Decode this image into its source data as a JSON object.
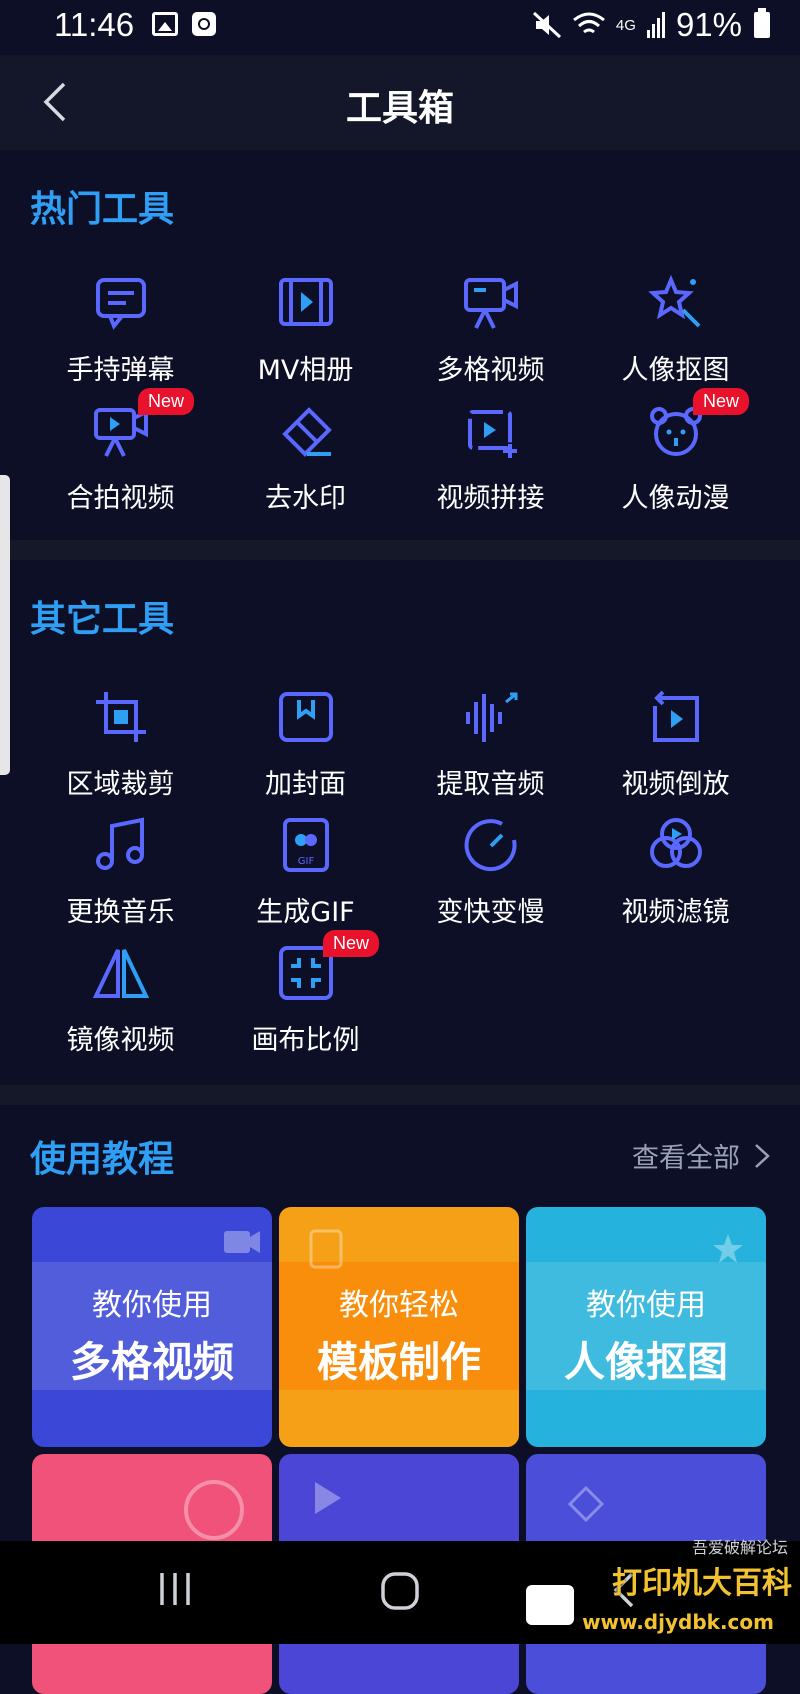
{
  "status_bar": {
    "time": "11:46",
    "battery": "91%",
    "network": "4G"
  },
  "header": {
    "title": "工具箱",
    "back_icon": "chevron-left-icon"
  },
  "hot_tools": {
    "title": "热门工具",
    "items": [
      {
        "label": "手持弹幕",
        "icon": "chat-bubble-icon"
      },
      {
        "label": "MV相册",
        "icon": "film-play-icon"
      },
      {
        "label": "多格视频",
        "icon": "camera-tripod-icon"
      },
      {
        "label": "人像抠图",
        "icon": "magic-star-icon"
      },
      {
        "label": "合拍视频",
        "icon": "video-camera-icon",
        "badge": "New"
      },
      {
        "label": "去水印",
        "icon": "eraser-icon"
      },
      {
        "label": "视频拼接",
        "icon": "video-frame-icon"
      },
      {
        "label": "人像动漫",
        "icon": "bear-face-icon",
        "badge": "New"
      }
    ]
  },
  "other_tools": {
    "title": "其它工具",
    "items": [
      {
        "label": "区域裁剪",
        "icon": "crop-icon"
      },
      {
        "label": "加封面",
        "icon": "cover-icon"
      },
      {
        "label": "提取音频",
        "icon": "audio-wave-icon"
      },
      {
        "label": "视频倒放",
        "icon": "rewind-icon"
      },
      {
        "label": "更换音乐",
        "icon": "music-note-icon"
      },
      {
        "label": "生成GIF",
        "icon": "gif-icon"
      },
      {
        "label": "变快变慢",
        "icon": "speed-gauge-icon"
      },
      {
        "label": "视频滤镜",
        "icon": "filter-circles-icon"
      },
      {
        "label": "镜像视频",
        "icon": "mirror-icon"
      },
      {
        "label": "画布比例",
        "icon": "canvas-ratio-icon",
        "badge": "New"
      }
    ]
  },
  "tutorials": {
    "title": "使用教程",
    "view_all": "查看全部",
    "cards": [
      {
        "line1": "教你使用",
        "line2": "多格视频",
        "color": "#3b47d6"
      },
      {
        "line1": "教你轻松",
        "line2": "模板制作",
        "color": "#f5a016"
      },
      {
        "line1": "教你使用",
        "line2": "人像抠图",
        "color": "#25b2dc"
      },
      {
        "line1": "",
        "line2": "",
        "color": "#f0527a"
      },
      {
        "line1": "",
        "line2": "",
        "color": "#4b46d6"
      },
      {
        "line1": "",
        "line2": "",
        "color": "#4a4ed8"
      }
    ]
  },
  "watermark": {
    "main": "打印机大百科",
    "sub": "www.djydbk.com",
    "corner": "吾爱破解论坛"
  },
  "colors": {
    "accent": "#2f9ff5",
    "icon": "#5a68ff",
    "background": "#0c0f26",
    "badge": "#e8122c"
  }
}
